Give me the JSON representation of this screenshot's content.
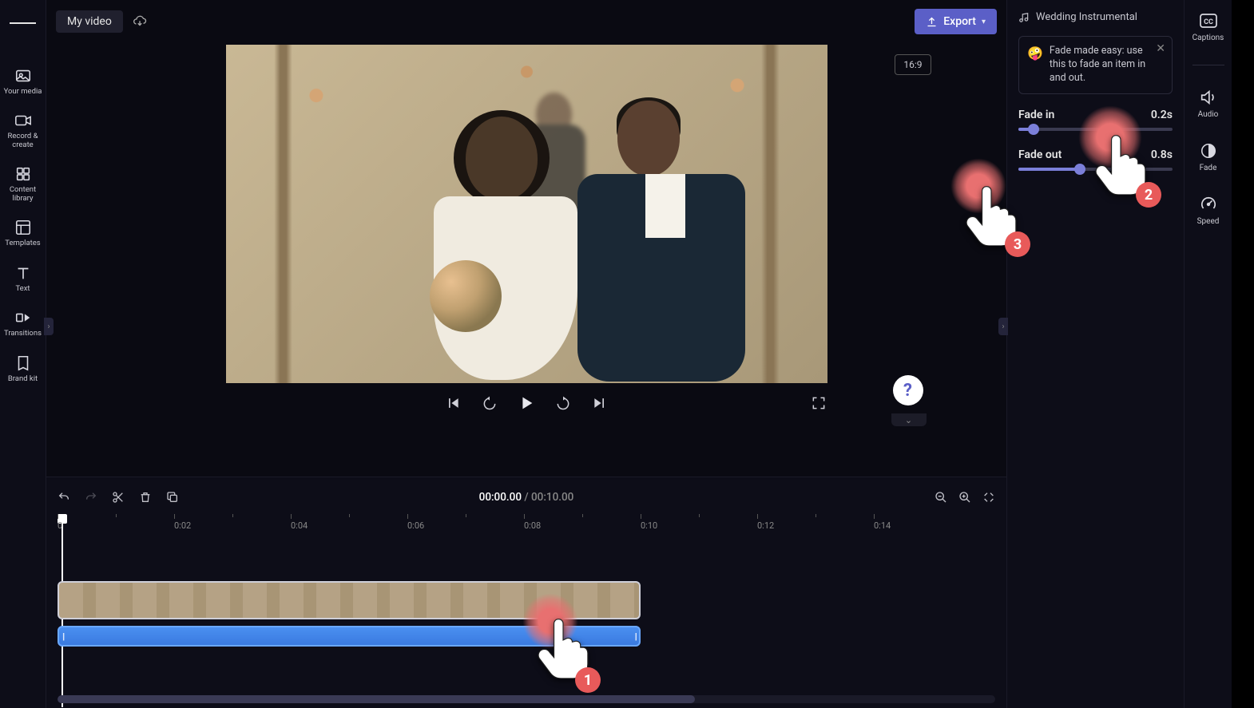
{
  "header": {
    "title": "My video",
    "export_label": "Export"
  },
  "sidebar": {
    "items": [
      {
        "label": "Your media",
        "icon": "media-icon"
      },
      {
        "label": "Record & create",
        "icon": "record-icon"
      },
      {
        "label": "Content library",
        "icon": "library-icon"
      },
      {
        "label": "Templates",
        "icon": "templates-icon"
      },
      {
        "label": "Text",
        "icon": "text-icon"
      },
      {
        "label": "Transitions",
        "icon": "transitions-icon"
      },
      {
        "label": "Brand kit",
        "icon": "brandkit-icon"
      }
    ]
  },
  "right_rail": {
    "items": [
      {
        "label": "Captions",
        "icon": "captions-icon"
      },
      {
        "label": "Audio",
        "icon": "audio-icon"
      },
      {
        "label": "Fade",
        "icon": "fade-icon"
      },
      {
        "label": "Speed",
        "icon": "speed-icon"
      }
    ]
  },
  "preview": {
    "aspect_label": "16:9"
  },
  "inspector": {
    "track_title": "Wedding Instrumental",
    "tip_text": "Fade made easy: use this to fade an item in and out.",
    "fade_in_label": "Fade in",
    "fade_in_value": "0.2s",
    "fade_in_pct": 10,
    "fade_out_label": "Fade out",
    "fade_out_value": "0.8s",
    "fade_out_pct": 40
  },
  "timeline": {
    "current_time": "00:00.00",
    "duration": "00:10.00",
    "ticks": [
      "0",
      "0:02",
      "0:04",
      "0:06",
      "0:08",
      "0:10",
      "0:12",
      "0:14"
    ]
  },
  "steps": {
    "s1": "1",
    "s2": "2",
    "s3": "3"
  }
}
